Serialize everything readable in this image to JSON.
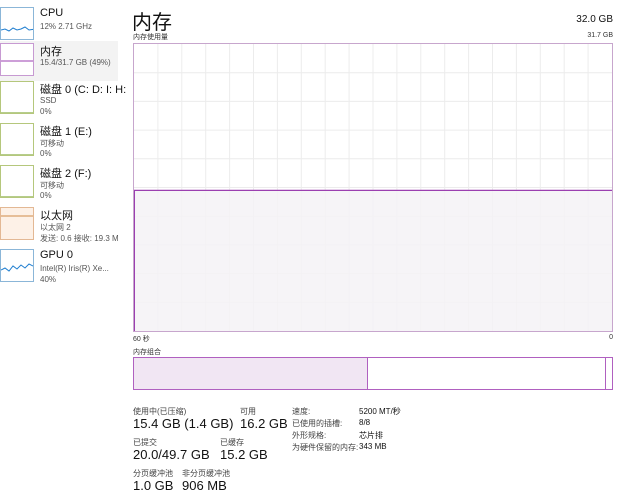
{
  "sidebar": {
    "items": [
      {
        "title": "CPU",
        "sub1": "12% 2.71 GHz",
        "sub2": ""
      },
      {
        "title": "内存",
        "sub1": "15.4/31.7 GB (49%)",
        "sub2": ""
      },
      {
        "title": "磁盘 0 (C: D: I: H:",
        "sub1": "SSD",
        "sub2": "0%"
      },
      {
        "title": "磁盘 1 (E:)",
        "sub1": "可移动",
        "sub2": "0%"
      },
      {
        "title": "磁盘 2 (F:)",
        "sub1": "可移动",
        "sub2": "0%"
      },
      {
        "title": "以太网",
        "sub1": "以太网 2",
        "sub2": "发送: 0.6 接收: 19.3 M"
      },
      {
        "title": "GPU 0",
        "sub1": "Intel(R) Iris(R) Xe...",
        "sub2": "40%"
      }
    ]
  },
  "header": {
    "title": "内存",
    "total": "32.0 GB",
    "usage_label": "内存使用量",
    "usage_max": "31.7 GB"
  },
  "graph": {
    "time_left": "60 秒",
    "time_right": "0",
    "usage_fraction": 0.49,
    "line_color": "#9b3fb0",
    "fill_color": "#f4f2f6"
  },
  "composition": {
    "label": "内存组合",
    "in_use_fraction": 0.49,
    "standby_start_fraction": 0.985
  },
  "stats": {
    "in_use_label": "使用中(已压缩)",
    "in_use_value": "15.4 GB (1.4 GB)",
    "available_label": "可用",
    "available_value": "16.2 GB",
    "committed_label": "已提交",
    "committed_value": "20.0/49.7 GB",
    "cached_label": "已缓存",
    "cached_value": "15.2 GB",
    "paged_label": "分页缓冲池",
    "paged_value": "1.0 GB",
    "nonpaged_label": "非分页缓冲池",
    "nonpaged_value": "906 MB"
  },
  "details": {
    "speed_key": "速度:",
    "speed_val": "5200 MT/秒",
    "slots_key": "已使用的插槽:",
    "slots_val": "8/8",
    "form_key": "外形规格:",
    "form_val": "芯片排",
    "reserved_key": "为硬件保留的内存:",
    "reserved_val": "343 MB"
  }
}
